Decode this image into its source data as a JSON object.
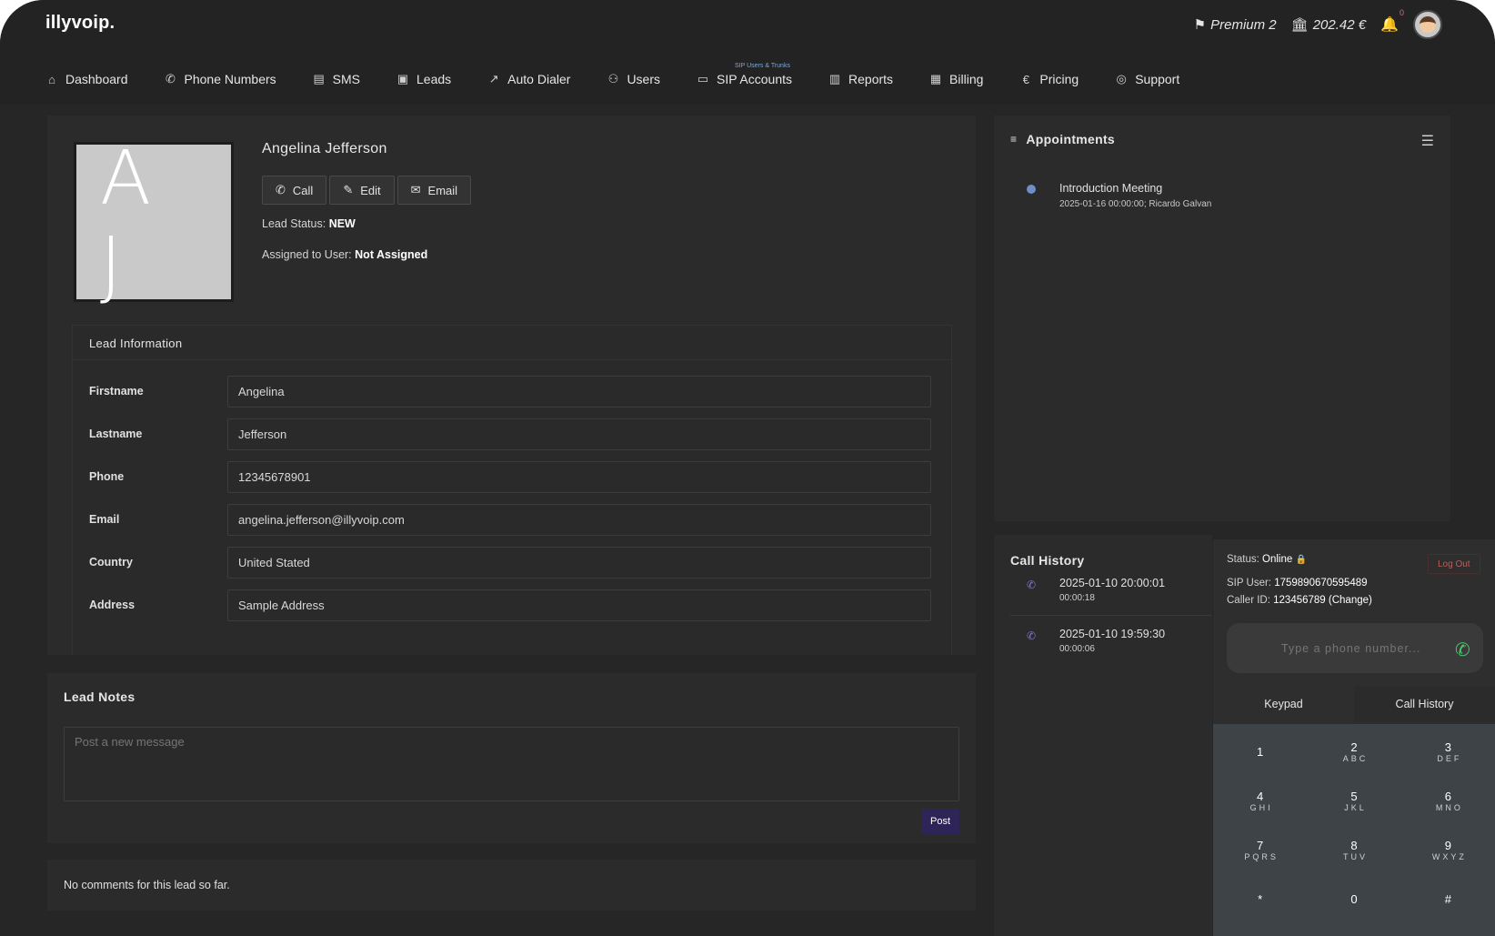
{
  "header": {
    "logo": "illyvoip.",
    "plan": "Premium 2",
    "balance": "202.42 €",
    "notifications_count": "0"
  },
  "nav": {
    "items": [
      {
        "label": "Dashboard",
        "icon": "home-icon"
      },
      {
        "label": "Phone Numbers",
        "icon": "phone-icon"
      },
      {
        "label": "SMS",
        "icon": "chat-icon"
      },
      {
        "label": "Leads",
        "icon": "contact-card-icon"
      },
      {
        "label": "Auto Dialer",
        "icon": "arrow-up-right-icon"
      },
      {
        "label": "Users",
        "icon": "users-icon"
      },
      {
        "label": "SIP Accounts",
        "icon": "devices-icon",
        "note": "SIP Users & Trunks"
      },
      {
        "label": "Reports",
        "icon": "bar-chart-icon"
      },
      {
        "label": "Billing",
        "icon": "receipt-icon"
      },
      {
        "label": "Pricing",
        "icon": "euro-icon"
      },
      {
        "label": "Support",
        "icon": "lifebuoy-icon"
      }
    ]
  },
  "lead": {
    "initials": "A J",
    "name": "Angelina Jefferson",
    "buttons": {
      "call": "Call",
      "edit": "Edit",
      "email": "Email"
    },
    "status_label": "Lead Status:",
    "status_value": "NEW",
    "assigned_label": "Assigned to User:",
    "assigned_value": "Not Assigned"
  },
  "lead_info": {
    "title": "Lead Information",
    "fields": [
      {
        "label": "Firstname",
        "value": "Angelina"
      },
      {
        "label": "Lastname",
        "value": "Jefferson"
      },
      {
        "label": "Phone",
        "value": "12345678901"
      },
      {
        "label": "Email",
        "value": "angelina.jefferson@illyvoip.com"
      },
      {
        "label": "Country",
        "value": "United Stated"
      },
      {
        "label": "Address",
        "value": "Sample Address"
      }
    ]
  },
  "notes": {
    "title": "Lead Notes",
    "placeholder": "Post a new message",
    "post_label": "Post",
    "empty_text": "No comments for this lead so far."
  },
  "appointments": {
    "title": "Appointments",
    "items": [
      {
        "name": "Introduction Meeting",
        "detail": "2025-01-16 00:00:00; Ricardo Galvan"
      }
    ]
  },
  "call_history": {
    "title": "Call History",
    "items": [
      {
        "datetime": "2025-01-10 20:00:01",
        "duration": "00:00:18"
      },
      {
        "datetime": "2025-01-10 19:59:30",
        "duration": "00:00:06"
      }
    ]
  },
  "softphone": {
    "status_label": "Status:",
    "status_value": "Online",
    "sip_label": "SIP User:",
    "sip_value": "1759890670595489",
    "cid_label": "Caller ID:",
    "cid_value": "123456789 (Change)",
    "logout_label": "Log Out",
    "input_placeholder": "Type a phone number...",
    "tabs": [
      "Keypad",
      "Call History"
    ],
    "keys": [
      {
        "digit": "1",
        "letters": ""
      },
      {
        "digit": "2",
        "letters": "ABC"
      },
      {
        "digit": "3",
        "letters": "DEF"
      },
      {
        "digit": "4",
        "letters": "GHI"
      },
      {
        "digit": "5",
        "letters": "JKL"
      },
      {
        "digit": "6",
        "letters": "MNO"
      },
      {
        "digit": "7",
        "letters": "PQRS"
      },
      {
        "digit": "8",
        "letters": "TUV"
      },
      {
        "digit": "9",
        "letters": "WXYZ"
      },
      {
        "digit": "*",
        "letters": ""
      },
      {
        "digit": "0",
        "letters": ""
      },
      {
        "digit": "#",
        "letters": ""
      }
    ]
  },
  "colors": {
    "background": "#262626",
    "card": "#2b2b2b",
    "accent_purple": "#2f2457",
    "call_green": "#4cc36d",
    "appointment_dot": "#6c8fc7"
  }
}
